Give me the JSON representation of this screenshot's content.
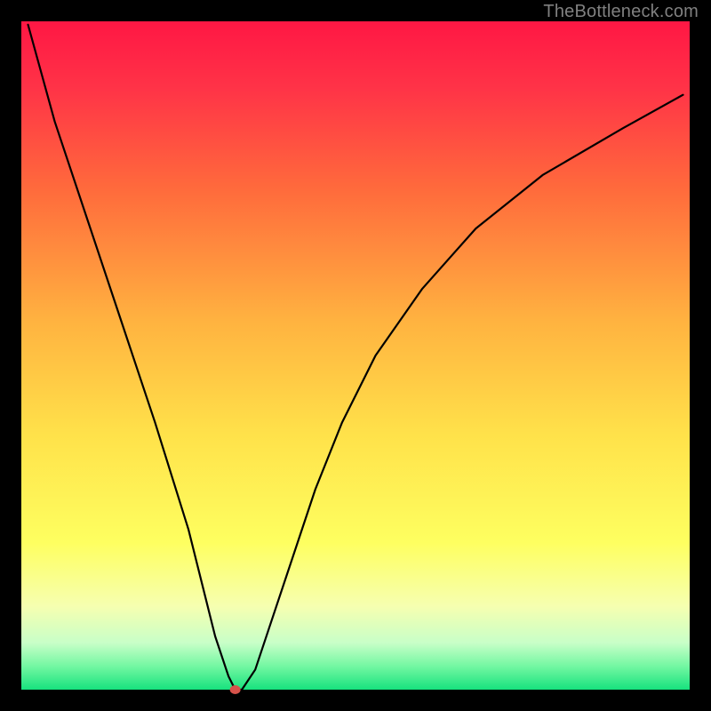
{
  "watermark": "TheBottleneck.com",
  "chart_data": {
    "type": "line",
    "title": "",
    "xlabel": "",
    "ylabel": "",
    "xlim": [
      0,
      100
    ],
    "ylim": [
      0,
      100
    ],
    "legend": false,
    "grid": false,
    "gradient_stops": [
      {
        "offset": 0.0,
        "color": "#ff1744"
      },
      {
        "offset": 0.1,
        "color": "#ff3347"
      },
      {
        "offset": 0.25,
        "color": "#ff6a3c"
      },
      {
        "offset": 0.45,
        "color": "#ffb340"
      },
      {
        "offset": 0.62,
        "color": "#ffe24a"
      },
      {
        "offset": 0.78,
        "color": "#feff60"
      },
      {
        "offset": 0.875,
        "color": "#f6ffb0"
      },
      {
        "offset": 0.93,
        "color": "#c8ffc8"
      },
      {
        "offset": 0.965,
        "color": "#73f7a2"
      },
      {
        "offset": 1.0,
        "color": "#17e27e"
      }
    ],
    "axis_border_width": 24,
    "series": [
      {
        "name": "bottleneck-curve",
        "description": "V-shaped bottleneck curve. Left leg nearly linear from top-left to minimum, right leg rises concavely and tapers off.",
        "x": [
          1,
          5,
          10,
          15,
          20,
          25,
          27,
          29,
          31,
          32,
          33,
          35,
          37,
          40,
          44,
          48,
          53,
          60,
          68,
          78,
          90,
          99
        ],
        "y": [
          99.5,
          85,
          70,
          55,
          40,
          24,
          16,
          8,
          2,
          0,
          0,
          3,
          9,
          18,
          30,
          40,
          50,
          60,
          69,
          77,
          84,
          89
        ],
        "marker_points": [
          {
            "x": 32,
            "y": 0,
            "color": "#d6524a",
            "radius": 5
          }
        ]
      }
    ],
    "annotations": []
  }
}
